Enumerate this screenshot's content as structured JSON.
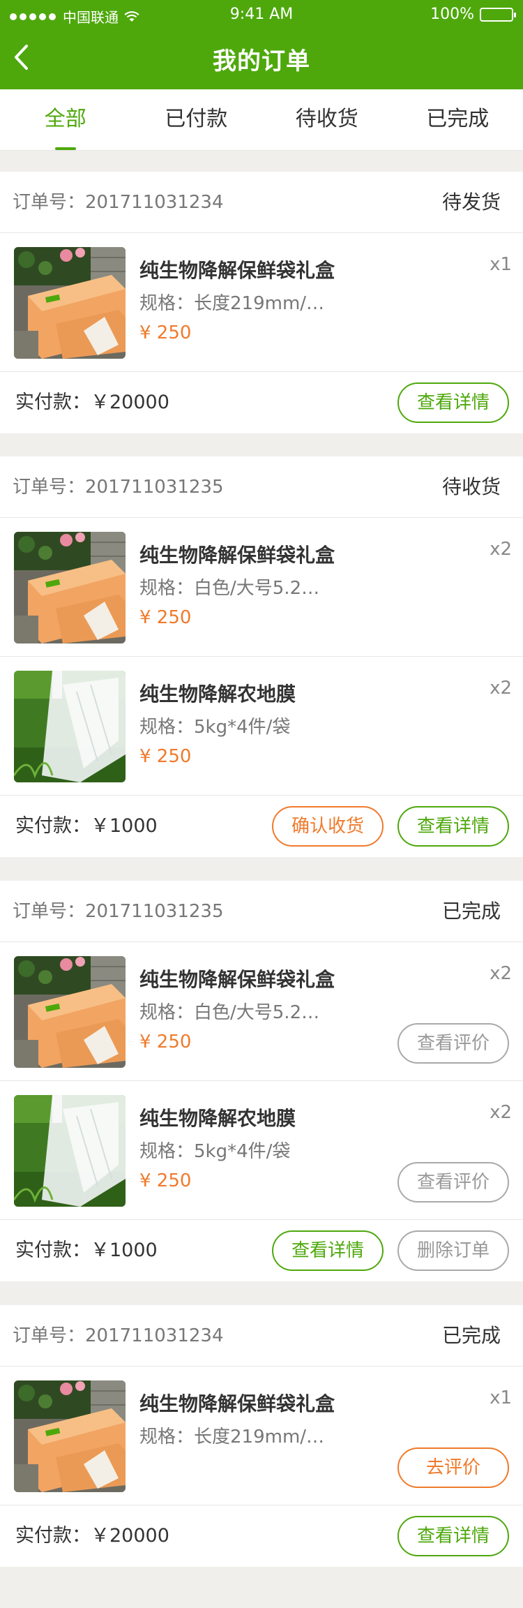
{
  "status_bar": {
    "carrier": "中国联通",
    "time": "9:41 AM",
    "battery": "100%"
  },
  "header": {
    "title": "我的订单",
    "back_icon": "chevron-left-icon"
  },
  "tabs": [
    {
      "label": "全部",
      "active": true
    },
    {
      "label": "已付款",
      "active": false
    },
    {
      "label": "待收货",
      "active": false
    },
    {
      "label": "已完成",
      "active": false
    }
  ],
  "orders": [
    {
      "order_no": "订单号：201711031234",
      "status": "待发货",
      "items": [
        {
          "name": "纯生物降解保鲜袋礼盒",
          "spec": "规格：长度219mm/…",
          "price": "¥ 250",
          "qty": "x1",
          "image": "gift-box-image"
        }
      ],
      "paid": "实付款：￥20000",
      "buttons": [
        {
          "label": "查看详情",
          "style": "green"
        }
      ]
    },
    {
      "order_no": "订单号：201711031235",
      "status": "待收货",
      "items": [
        {
          "name": "纯生物降解保鲜袋礼盒",
          "spec": "规格：白色/大号5.2…",
          "price": "¥ 250",
          "qty": "x2",
          "image": "gift-box-image"
        },
        {
          "name": "纯生物降解农地膜",
          "spec": "规格：5kg*4件/袋",
          "price": "¥ 250",
          "qty": "x2",
          "image": "film-roll-image"
        }
      ],
      "paid": "实付款：￥1000",
      "buttons": [
        {
          "label": "确认收货",
          "style": "orange"
        },
        {
          "label": "查看详情",
          "style": "green"
        }
      ]
    },
    {
      "order_no": "订单号：201711031235",
      "status": "已完成",
      "items": [
        {
          "name": "纯生物降解保鲜袋礼盒",
          "spec": "规格：白色/大号5.2…",
          "price": "¥ 250",
          "qty": "x2",
          "image": "gift-box-image",
          "item_button": "查看评价"
        },
        {
          "name": "纯生物降解农地膜",
          "spec": "规格：5kg*4件/袋",
          "price": "¥ 250",
          "qty": "x2",
          "image": "film-roll-image",
          "item_button": "查看评价"
        }
      ],
      "paid": "实付款：￥1000",
      "buttons": [
        {
          "label": "查看详情",
          "style": "green"
        },
        {
          "label": "删除订单",
          "style": "gray"
        }
      ]
    },
    {
      "order_no": "订单号：201711031234",
      "status": "已完成",
      "items": [
        {
          "name": "纯生物降解保鲜袋礼盒",
          "spec": "规格：长度219mm/…",
          "price": "",
          "qty": "x1",
          "image": "gift-box-image",
          "item_button": "去评价"
        }
      ],
      "paid": "实付款：￥20000",
      "buttons": [
        {
          "label": "查看详情",
          "style": "green"
        }
      ]
    }
  ],
  "colors": {
    "brand_green": "#4ea80c",
    "price_orange": "#f07a2b",
    "page_bg": "#f0efeb"
  }
}
